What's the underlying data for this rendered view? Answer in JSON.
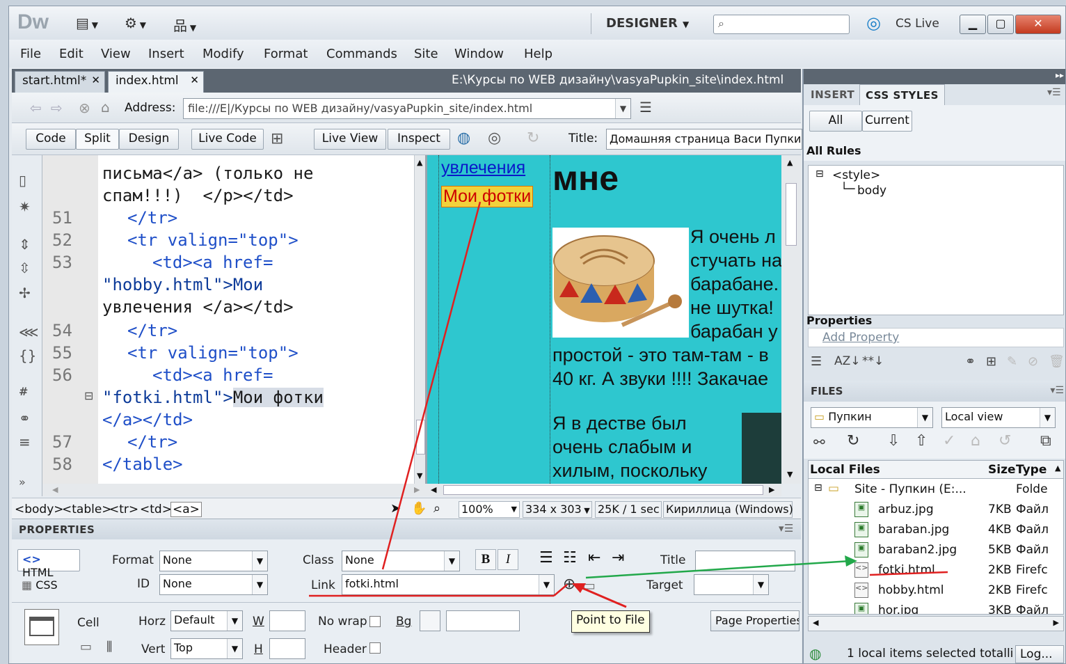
{
  "app": {
    "logo": "Dw",
    "workspace": "DESIGNER",
    "cs_live": "CS Live"
  },
  "menu": [
    "File",
    "Edit",
    "View",
    "Insert",
    "Modify",
    "Format",
    "Commands",
    "Site",
    "Window",
    "Help"
  ],
  "doc_tabs": [
    {
      "label": "start.html*"
    },
    {
      "label": "index.html"
    }
  ],
  "doc_path": "E:\\Курсы по WEB дизайну\\vasyaPupkin_site\\index.html",
  "address": {
    "label": "Address:",
    "value": "file:///E|/Курсы по WEB дизайну/vasyaPupkin_site/index.html"
  },
  "view_buttons": {
    "code": "Code",
    "split": "Split",
    "design": "Design",
    "live_code": "Live Code",
    "live_view": "Live View",
    "inspect": "Inspect"
  },
  "page_title": {
    "label": "Title:",
    "value": "Домашняя страница Васи Пупкина"
  },
  "code": {
    "line_numbers": [
      "51",
      "52",
      "53",
      "54",
      "55",
      "56",
      "57",
      "58"
    ],
    "l1": "письма</a> (только не",
    "l2": "спам!!!)  </p></td>",
    "l3": "</tr>",
    "l4": "<tr valign=\"top\">",
    "l5": "<td><a href=",
    "l6": "\"hobby.html\">Мои",
    "l7": "увлечения </a></td>",
    "l8": "</tr>",
    "l9": "<tr valign=\"top\">",
    "l10": "<td><a href=",
    "l11a": "\"fotki.html\">",
    "l11b": "Мои фотки",
    "l12": "</a></td>",
    "l13": "</tr>",
    "l14": "</table>"
  },
  "design": {
    "link1": "увлечения",
    "link2": "Мои фотки",
    "heading": "мне",
    "p1": [
      "Я очень л",
      "стучать на",
      "барабане.",
      "не шутка!",
      "барабан у"
    ],
    "p2": [
      "простой - это там-там - в",
      "40 кг. А звуки !!!! Закачае"
    ],
    "p3": [
      "Я в дестве был",
      "очень слабым и",
      "хилым, поскольку"
    ]
  },
  "status": {
    "breadcrumb": [
      "<body>",
      "<table>",
      "<tr>",
      "<td>",
      "<a>"
    ],
    "zoom": "100%",
    "size": "334 x 303",
    "download": "25K / 1 sec",
    "encoding": "Кириллица (Windows)"
  },
  "properties": {
    "header": "PROPERTIES",
    "html_btn": "HTML",
    "css_btn": "CSS",
    "format_label": "Format",
    "format_value": "None",
    "id_label": "ID",
    "id_value": "None",
    "class_label": "Class",
    "class_value": "None",
    "link_label": "Link",
    "link_value": "fotki.html",
    "title_label": "Title",
    "target_label": "Target",
    "cell_label": "Cell",
    "horz_label": "Horz",
    "horz_value": "Default",
    "vert_label": "Vert",
    "vert_value": "Top",
    "w_label": "W",
    "h_label": "H",
    "nowrap_label": "No wrap",
    "bg_label": "Bg",
    "header_label": "Header",
    "page_props": "Page Properties...",
    "tooltip": "Point to File"
  },
  "right_panel": {
    "tab_insert": "INSERT",
    "tab_css": "CSS STYLES",
    "all": "All",
    "current": "Current",
    "all_rules": "All Rules",
    "rule_style": "<style>",
    "rule_body": "body",
    "properties": "Properties",
    "add_property": "Add Property",
    "files_header": "FILES",
    "site": "Пупкин",
    "view": "Local view",
    "col_local": "Local Files",
    "col_size": "Size",
    "col_type": "Type",
    "root": {
      "name": "Site - Пупкин (E:...",
      "type": "Folde"
    },
    "files": [
      {
        "name": "arbuz.jpg",
        "size": "7KB",
        "type": "Файл"
      },
      {
        "name": "baraban.jpg",
        "size": "4KB",
        "type": "Файл"
      },
      {
        "name": "baraban2.jpg",
        "size": "5KB",
        "type": "Файл"
      },
      {
        "name": "fotki.html",
        "size": "2KB",
        "type": "Firefc"
      },
      {
        "name": "hobby.html",
        "size": "2KB",
        "type": "Firefc"
      },
      {
        "name": "hor.jpg",
        "size": "3KB",
        "type": "Файл"
      }
    ],
    "status": "1 local items selected totalli",
    "log": "Log..."
  }
}
